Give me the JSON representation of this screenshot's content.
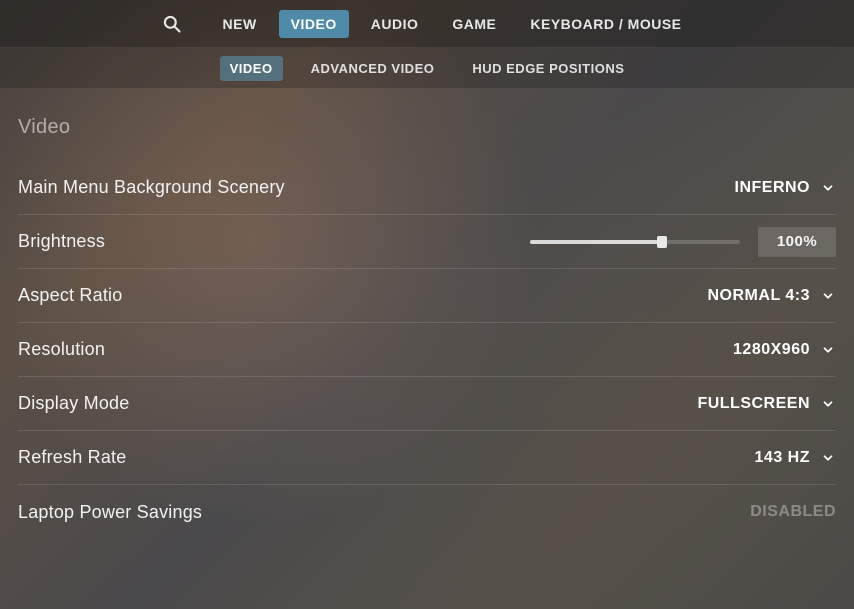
{
  "topTabs": {
    "items": [
      "NEW",
      "VIDEO",
      "AUDIO",
      "GAME",
      "KEYBOARD / MOUSE"
    ],
    "activeIndex": 1
  },
  "subTabs": {
    "items": [
      "VIDEO",
      "ADVANCED VIDEO",
      "HUD EDGE POSITIONS"
    ],
    "activeIndex": 0
  },
  "section": {
    "title": "Video"
  },
  "settings": {
    "scenery": {
      "label": "Main Menu Background Scenery",
      "value": "INFERNO"
    },
    "brightness": {
      "label": "Brightness",
      "percent": 63,
      "display": "100%"
    },
    "aspect": {
      "label": "Aspect Ratio",
      "value": "NORMAL 4:3"
    },
    "resolution": {
      "label": "Resolution",
      "value": "1280X960"
    },
    "displayMode": {
      "label": "Display Mode",
      "value": "FULLSCREEN"
    },
    "refresh": {
      "label": "Refresh Rate",
      "value": "143 HZ"
    },
    "laptop": {
      "label": "Laptop Power Savings",
      "value": "DISABLED"
    }
  }
}
